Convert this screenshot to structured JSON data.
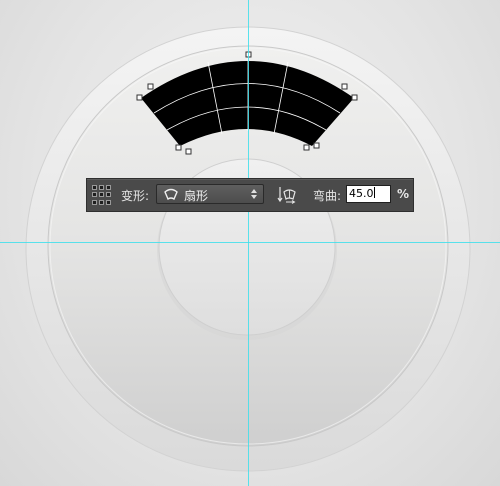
{
  "toolbar": {
    "warp_label": "变形:",
    "warp_style_value": "扇形",
    "bend_label": "弯曲:",
    "bend_value": "45.0",
    "percent_symbol": "%"
  },
  "icons": {
    "reference_point": "reference-point-grid-icon",
    "arc_style": "arc-style-icon",
    "select_arrow": "updown-arrow-icon",
    "warp_orientation": "warp-orientation-icon"
  },
  "colors": {
    "guide": "#3fe0ec",
    "toolbar_bg": "#4a4a4a",
    "warp_shape": "#000000"
  }
}
